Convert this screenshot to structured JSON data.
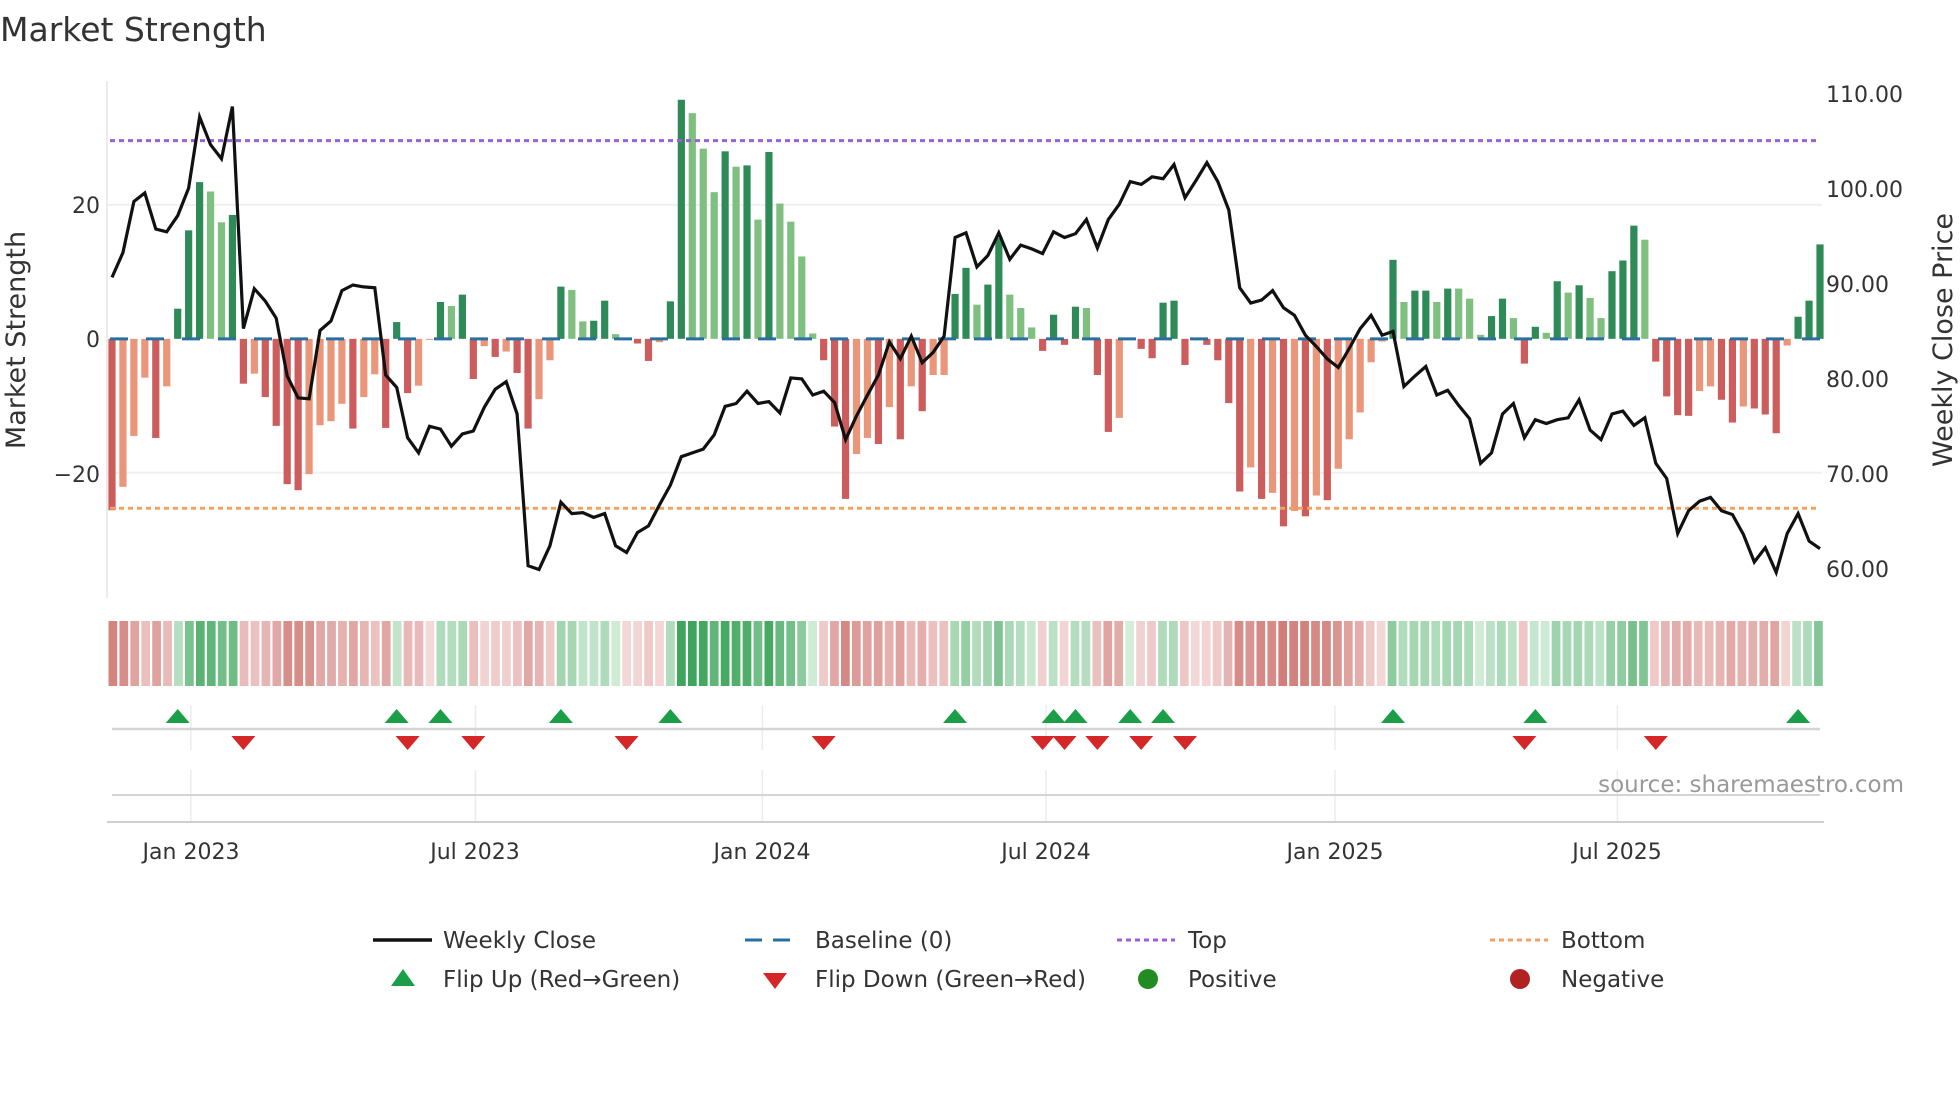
{
  "title": "Market Strength",
  "source": "source: sharemaestro.com",
  "legend": {
    "weekly_close": "Weekly Close",
    "baseline": "Baseline (0)",
    "top": "Top",
    "bottom": "Bottom",
    "flip_up": "Flip Up (Red→Green)",
    "flip_down": "Flip Down (Green→Red)",
    "positive": "Positive",
    "negative": "Negative"
  },
  "colors": {
    "pos_dark": "#2e8b57",
    "pos_light": "#7fbf7f",
    "neg_dark": "#cd5c5c",
    "neg_light": "#e9967a",
    "baseline": "#2a6fa0",
    "top": "#9d5fd8",
    "bottom": "#f2a25c",
    "close": "#111111",
    "flip_up": "#1a9e48",
    "flip_down": "#d62728",
    "positive": "#228b22",
    "negative": "#b22222"
  },
  "chart_data": {
    "type": "bar+line",
    "title": "Market Strength",
    "ylabel_left": "Market Strength",
    "ylabel_right": "Weekly Close Price",
    "ylim_left": [
      -38.7,
      38.5
    ],
    "ylim_right": [
      56.9,
      111.4
    ],
    "left_ticks": [
      {
        "value": 20,
        "label": "20"
      },
      {
        "value": 0,
        "label": "0"
      },
      {
        "value": -20,
        "label": "−20"
      }
    ],
    "right_ticks": [
      {
        "value": 110,
        "label": "110.00"
      },
      {
        "value": 100,
        "label": "100.00"
      },
      {
        "value": 90,
        "label": "90.00"
      },
      {
        "value": 80,
        "label": "80.00"
      },
      {
        "value": 70,
        "label": "70.00"
      },
      {
        "value": 60,
        "label": "60.00"
      }
    ],
    "x_ticks": [
      {
        "week": 7.2,
        "label": "Jan 2023"
      },
      {
        "week": 33.2,
        "label": "Jul 2023"
      },
      {
        "week": 59.4,
        "label": "Jan 2024"
      },
      {
        "week": 85.3,
        "label": "Jul 2024"
      },
      {
        "week": 111.7,
        "label": "Jan 2025"
      },
      {
        "week": 137.5,
        "label": "Jul 2025"
      }
    ],
    "top_level": 29.6,
    "bottom_level": -25.3,
    "baseline": 0,
    "strength": [
      -25.6,
      -22.1,
      -14.5,
      -5.8,
      -14.8,
      -7.1,
      4.5,
      16.2,
      23.4,
      22.0,
      17.4,
      18.5,
      -6.7,
      -5.2,
      -8.7,
      -13.0,
      -21.7,
      -22.6,
      -20.2,
      -12.9,
      -12.3,
      -9.7,
      -13.4,
      -8.7,
      -5.3,
      -13.3,
      2.5,
      -8.1,
      -7.0,
      -0.1,
      5.5,
      4.9,
      6.6,
      -6.0,
      -1.1,
      -2.7,
      -1.9,
      -5.1,
      -13.4,
      -9.0,
      -3.2,
      7.8,
      7.3,
      2.6,
      2.7,
      5.7,
      0.7,
      -0.2,
      -0.7,
      -3.3,
      -0.5,
      5.6,
      35.7,
      33.7,
      28.4,
      21.9,
      28.0,
      25.7,
      25.9,
      17.8,
      27.9,
      20.2,
      17.5,
      12.3,
      0.8,
      -3.2,
      -13.1,
      -23.9,
      -17.2,
      -14.8,
      -15.7,
      -10.2,
      -15.0,
      -7.1,
      -10.8,
      -5.4,
      -5.4,
      6.7,
      10.6,
      5.1,
      8.1,
      15.1,
      6.6,
      4.6,
      1.7,
      -1.8,
      3.6,
      -0.9,
      4.8,
      4.6,
      -5.4,
      -13.9,
      -11.8,
      0.2,
      -1.5,
      -2.9,
      5.4,
      5.7,
      -3.9,
      -0.2,
      -0.9,
      -3.2,
      -9.6,
      -22.8,
      -19.2,
      -23.9,
      -23.0,
      -28.0,
      -25.7,
      -26.5,
      -23.4,
      -24.1,
      -19.4,
      -15.0,
      -11.0,
      -3.5,
      -0.4,
      11.8,
      5.5,
      7.2,
      7.2,
      5.5,
      7.5,
      7.5,
      6.0,
      0.6,
      3.4,
      6.0,
      3.1,
      -3.7,
      1.8,
      0.9,
      8.6,
      6.9,
      8.0,
      6.1,
      3.1,
      10.1,
      11.7,
      16.9,
      14.8,
      -3.4,
      -8.6,
      -11.4,
      -11.5,
      -7.8,
      -7.1,
      -9.1,
      -12.5,
      -10.1,
      -10.4,
      -11.3,
      -14.1,
      -1.0,
      3.3,
      5.7,
      14.1
    ],
    "strength_shade_dark": [
      1,
      0,
      0,
      0,
      1,
      0,
      1,
      1,
      1,
      0,
      0,
      1,
      1,
      0,
      1,
      1,
      1,
      1,
      0,
      0,
      0,
      0,
      1,
      0,
      0,
      1,
      1,
      1,
      0,
      0,
      1,
      0,
      1,
      1,
      0,
      1,
      0,
      1,
      1,
      0,
      0,
      1,
      0,
      0,
      1,
      1,
      0,
      0,
      1,
      1,
      0,
      1,
      1,
      0,
      0,
      0,
      1,
      0,
      1,
      0,
      1,
      0,
      0,
      0,
      0,
      1,
      1,
      1,
      0,
      0,
      1,
      0,
      1,
      0,
      1,
      0,
      0,
      1,
      1,
      0,
      1,
      1,
      0,
      0,
      0,
      1,
      1,
      1,
      1,
      0,
      1,
      1,
      0,
      0,
      1,
      1,
      1,
      1,
      1,
      0,
      1,
      1,
      1,
      1,
      0,
      1,
      0,
      1,
      0,
      1,
      0,
      1,
      0,
      0,
      0,
      0,
      0,
      1,
      0,
      1,
      1,
      0,
      1,
      0,
      0,
      0,
      1,
      1,
      0,
      1,
      1,
      0,
      1,
      0,
      1,
      0,
      0,
      1,
      1,
      1,
      0,
      1,
      1,
      1,
      1,
      0,
      0,
      1,
      1,
      0,
      1,
      1,
      1,
      0,
      1,
      1,
      1
    ],
    "weekly_close": [
      90.7,
      93.3,
      98.7,
      99.6,
      95.8,
      95.5,
      97.2,
      100.1,
      107.6,
      104.7,
      103.2,
      108.7,
      85.3,
      89.5,
      88.2,
      86.4,
      80.3,
      78.0,
      77.9,
      85.1,
      86.1,
      89.3,
      89.9,
      89.7,
      89.6,
      80.4,
      79.1,
      73.8,
      72.2,
      75.0,
      74.7,
      72.9,
      74.2,
      74.5,
      77.0,
      78.9,
      79.7,
      76.3,
      60.3,
      59.9,
      62.4,
      67.0,
      65.8,
      65.9,
      65.4,
      65.8,
      62.4,
      61.7,
      63.8,
      64.5,
      66.7,
      68.8,
      71.8,
      72.2,
      72.6,
      74.1,
      77.1,
      77.4,
      78.7,
      77.4,
      77.6,
      76.4,
      80.1,
      80.0,
      78.3,
      78.7,
      77.5,
      73.6,
      76.1,
      78.3,
      80.4,
      83.9,
      82.1,
      84.5,
      81.7,
      82.8,
      84.5,
      94.9,
      95.4,
      91.8,
      93.0,
      95.4,
      92.6,
      94.1,
      93.7,
      93.2,
      95.5,
      94.9,
      95.3,
      96.8,
      93.8,
      96.8,
      98.4,
      100.8,
      100.5,
      101.3,
      101.1,
      102.6,
      99.1,
      100.9,
      102.8,
      100.8,
      97.8,
      89.6,
      88.0,
      88.3,
      89.3,
      87.5,
      86.7,
      84.6,
      83.4,
      82.1,
      81.2,
      83.2,
      85.3,
      86.7,
      84.6,
      85.0,
      79.2,
      80.3,
      81.3,
      78.3,
      78.8,
      77.2,
      75.8,
      71.1,
      72.2,
      76.3,
      77.4,
      73.8,
      75.7,
      75.3,
      75.7,
      75.9,
      77.8,
      74.6,
      73.6,
      76.3,
      76.6,
      75.1,
      75.9,
      71.1,
      69.5,
      63.7,
      66.1,
      67.1,
      67.5,
      66.1,
      65.7,
      63.6,
      60.7,
      62.2,
      59.6,
      63.7,
      65.8,
      62.9,
      62.1
    ],
    "legend_placement": "bottom-center",
    "grid": true
  }
}
